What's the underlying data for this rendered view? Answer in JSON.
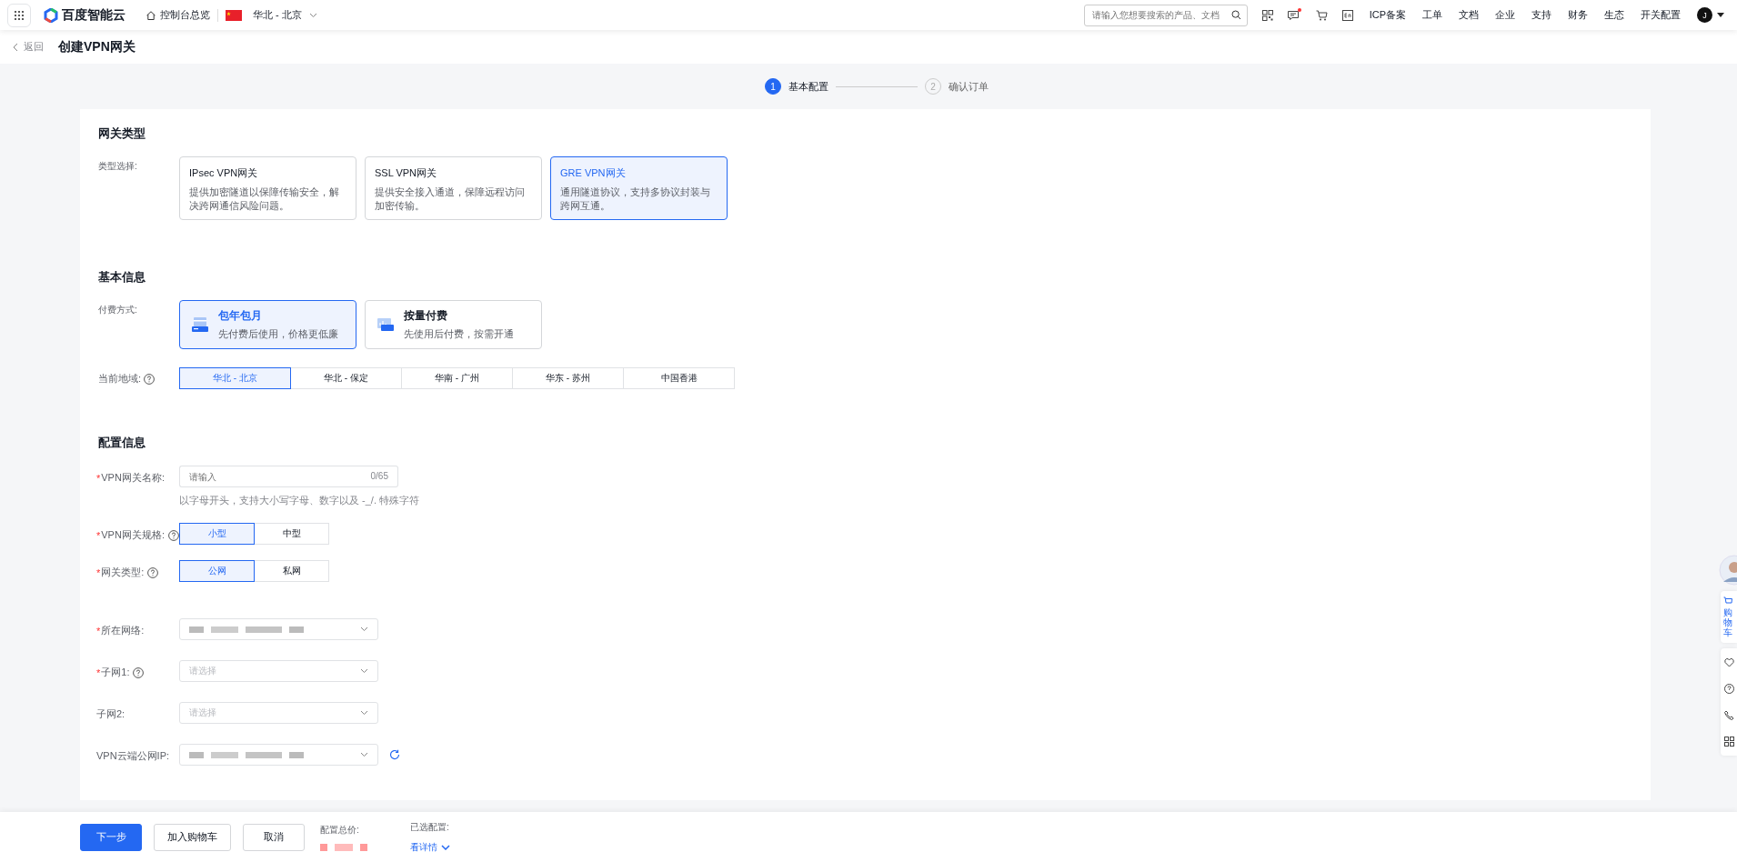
{
  "header": {
    "brand": "百度智能云",
    "console_link": "控制台总览",
    "region": "华北 - 北京",
    "search": {
      "placeholder": "请输入您想要搜索的产品、文档"
    },
    "notifications_unread": true,
    "nav": [
      "ICP备案",
      "工单",
      "文档",
      "企业",
      "支持",
      "财务",
      "生态",
      "开关配置"
    ],
    "avatar": "J"
  },
  "page": {
    "back": "返回",
    "title": "创建VPN网关"
  },
  "steps": [
    {
      "number": "1",
      "label": "基本配置",
      "selected": true
    },
    {
      "number": "2",
      "label": "确认订单",
      "selected": false
    }
  ],
  "gateway_type": {
    "title": "网关类型",
    "label": "类型选择:",
    "options": [
      {
        "name": "IPsec VPN网关",
        "description": "提供加密隧道以保障传输安全，解决跨网通信风险问题。",
        "selected": false
      },
      {
        "name": "SSL VPN网关",
        "description": "提供安全接入通道，保障远程访问加密传输。",
        "selected": false
      },
      {
        "name": "GRE VPN网关",
        "description": "通用隧道协议，支持多协议封装与跨网互通。",
        "selected": true
      }
    ]
  },
  "basic_info": {
    "title": "基本信息",
    "billing_label": "付费方式:",
    "billing": [
      {
        "name": "包年包月",
        "description": "先付费后使用，价格更低廉",
        "kind": "calendar",
        "selected": true
      },
      {
        "name": "按量付费",
        "description": "先使用后付费，按需开通",
        "kind": "meter",
        "selected": false
      }
    ],
    "region_label": "当前地域:",
    "regions": [
      {
        "label": "华北 - 北京",
        "selected": true
      },
      {
        "label": "华北 - 保定",
        "selected": false
      },
      {
        "label": "华南 - 广州",
        "selected": false
      },
      {
        "label": "华东 - 苏州",
        "selected": false
      },
      {
        "label": "中国香港",
        "selected": false
      }
    ]
  },
  "config": {
    "title": "配置信息",
    "fields": [
      {
        "kind": "text",
        "label": "VPN网关名称:",
        "required_mark": "*",
        "help": false,
        "placeholder": "请输入",
        "counter": "0/65",
        "hint": "以字母开头，支持大小写字母、数字以及 -_/. 特殊字符"
      },
      {
        "kind": "segmented",
        "label": "VPN网关规格:",
        "required_mark": "*",
        "help": true,
        "options": [
          {
            "label": "小型",
            "selected": true
          },
          {
            "label": "中型",
            "selected": false
          }
        ]
      },
      {
        "kind": "segmented",
        "label": "网关类型:",
        "required_mark": "*",
        "help": true,
        "options": [
          {
            "label": "公网",
            "selected": true
          },
          {
            "label": "私网",
            "selected": false
          }
        ]
      },
      {
        "kind": "select",
        "label": "所在网络:",
        "required_mark": "*",
        "help": false,
        "masked": true
      },
      {
        "kind": "select",
        "label": "子网1:",
        "required_mark": "*",
        "help": true,
        "masked": false,
        "placeholder": "请选择"
      },
      {
        "kind": "select",
        "label": "子网2:",
        "help": false,
        "masked": false,
        "placeholder": "请选择"
      },
      {
        "kind": "select",
        "label": "VPN云端公网IP:",
        "help": false,
        "masked": true,
        "refresh": true
      }
    ]
  },
  "footer": {
    "buttons": [
      {
        "label": "下一步",
        "kind": "primary"
      },
      {
        "label": "加入购物车",
        "kind": "default"
      },
      {
        "label": "取消",
        "kind": "default"
      }
    ],
    "price_label": "配置总价:",
    "price_masked": true,
    "selected_label": "已选配置:",
    "details_link": "看详情"
  },
  "side_panel": {
    "cart": "购物车"
  }
}
